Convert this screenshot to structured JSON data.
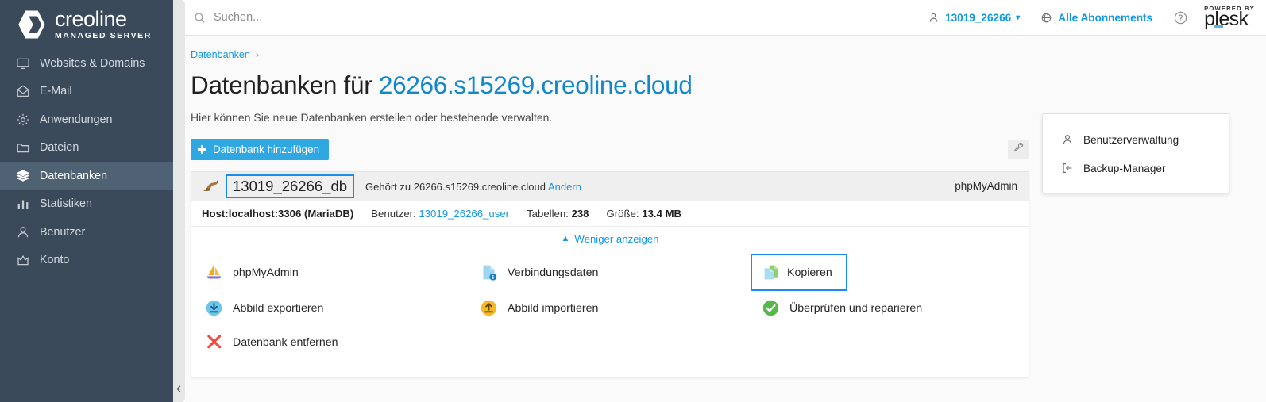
{
  "brand": {
    "logo_title": "creoline",
    "logo_subtitle": "MANAGED SERVER",
    "logo_icon": "hexagon-logo-icon"
  },
  "sidebar": {
    "items": [
      {
        "label": "Websites & Domains",
        "icon": "monitor-icon",
        "active": false
      },
      {
        "label": "E-Mail",
        "icon": "envelope-icon",
        "active": false
      },
      {
        "label": "Anwendungen",
        "icon": "gear-icon",
        "active": false
      },
      {
        "label": "Dateien",
        "icon": "folder-icon",
        "active": false
      },
      {
        "label": "Datenbanken",
        "icon": "database-stack-icon",
        "active": true
      },
      {
        "label": "Statistiken",
        "icon": "bar-chart-icon",
        "active": false
      },
      {
        "label": "Benutzer",
        "icon": "person-icon",
        "active": false
      },
      {
        "label": "Konto",
        "icon": "crown-icon",
        "active": false
      }
    ],
    "collapse_icon": "chevron-left-icon"
  },
  "topbar": {
    "search_placeholder": "Suchen...",
    "search_value": "",
    "search_icon": "search-icon",
    "account": {
      "label": "13019_26266",
      "icon": "person-icon",
      "caret": "chevron-down-icon"
    },
    "subscriptions": {
      "label": "Alle Abonnements",
      "icon": "globe-icon"
    },
    "help_icon": "question-circle-icon",
    "plesk": {
      "powered_by": "POWERED BY",
      "word": "plesk"
    }
  },
  "breadcrumb": {
    "items": [
      "Datenbanken"
    ],
    "separator": "›"
  },
  "page": {
    "title_prefix": "Datenbanken für ",
    "title_host": "26266.s15269.creoline.cloud",
    "description": "Hier können Sie neue Datenbanken erstellen oder bestehende verwalten."
  },
  "toolbar": {
    "add_db_label": "Datenbank hinzufügen",
    "add_icon": "plus-icon",
    "tools_icon": "wrench-icon"
  },
  "database": {
    "icon": "mariadb-sealion-icon",
    "name": "13019_26266_db",
    "owner_prefix": "Gehört zu ",
    "owner_host": "26266.s15269.creoline.cloud",
    "change_link": "Ändern",
    "phpmyadmin_link": "phpMyAdmin",
    "meta": {
      "host_label": "Host:",
      "host_value": "localhost:3306 (MariaDB)",
      "user_label": "Benutzer: ",
      "user_value": "13019_26266_user",
      "tables_label": "Tabellen: ",
      "tables_value": "238",
      "size_label": "Größe: ",
      "size_value": "13.4 MB"
    },
    "toggle_label": "Weniger anzeigen",
    "toggle_icon": "chevron-up-icon",
    "actions": [
      {
        "label": "phpMyAdmin",
        "icon": "sailboat-icon",
        "highlight": false
      },
      {
        "label": "Verbindungsdaten",
        "icon": "document-info-icon",
        "highlight": false
      },
      {
        "label": "Kopieren",
        "icon": "copy-documents-icon",
        "highlight": true
      },
      {
        "label": "Abbild exportieren",
        "icon": "download-circle-icon",
        "highlight": false
      },
      {
        "label": "Abbild importieren",
        "icon": "upload-circle-icon",
        "highlight": false
      },
      {
        "label": "Überprüfen und reparieren",
        "icon": "check-circle-icon",
        "highlight": false
      },
      {
        "label": "Datenbank entfernen",
        "icon": "red-x-icon",
        "highlight": false
      }
    ]
  },
  "side_menu": {
    "items": [
      {
        "label": "Benutzerverwaltung",
        "icon": "person-icon"
      },
      {
        "label": "Backup-Manager",
        "icon": "backup-arrow-icon"
      }
    ]
  },
  "colors": {
    "sidebar_bg": "#3b4a5a",
    "sidebar_active": "#4f6273",
    "link_blue": "#1199dd",
    "button_blue": "#2fa7e0",
    "highlight_blue": "#1a8cf0",
    "content_bg": "#fafafa"
  }
}
